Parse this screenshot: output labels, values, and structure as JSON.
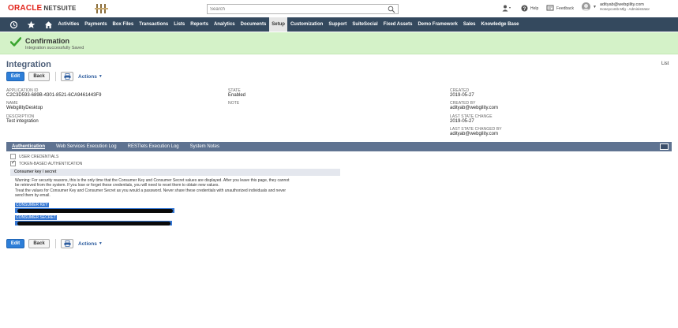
{
  "header": {
    "logo_oracle": "ORACLE",
    "logo_netsuite": "NETSUITE",
    "search_placeholder": "Search",
    "help_label": "Help",
    "feedback_label": "Feedback",
    "user_email": "adityab@webgility.com",
    "user_role": "Honeycomb Mfg - Administrator"
  },
  "nav": {
    "items": [
      "Activities",
      "Payments",
      "Box Files",
      "Transactions",
      "Lists",
      "Reports",
      "Analytics",
      "Documents",
      "Setup",
      "Customization",
      "Support",
      "SuiteSocial",
      "Fixed Assets",
      "Demo Framework",
      "Sales",
      "Knowledge Base"
    ],
    "active": "Setup"
  },
  "confirmation": {
    "title": "Confirmation",
    "message": "Integration successfully Saved"
  },
  "page": {
    "title": "Integration",
    "list_link": "List"
  },
  "buttons": {
    "edit": "Edit",
    "back": "Back",
    "actions": "Actions"
  },
  "fields": {
    "application_id_label": "APPLICATION ID",
    "application_id": "C2C3D593-689B-4301-8521-6CA9461443F9",
    "name_label": "NAME",
    "name": "WebgilityDesktop",
    "description_label": "DESCRIPTION",
    "description": "Test integration",
    "state_label": "STATE",
    "state": "Enabled",
    "note_label": "NOTE",
    "created_label": "CREATED",
    "created": "2019-05-27",
    "created_by_label": "CREATED BY",
    "created_by": "adityab@webgility.com",
    "last_state_change_label": "LAST STATE CHANGE",
    "last_state_change": "2019-05-27",
    "last_state_changed_by_label": "LAST STATE CHANGED BY",
    "last_state_changed_by": "adityab@webgility.com"
  },
  "subtabs": {
    "authentication": "Authentication",
    "web_services_log": "Web Services Execution Log",
    "restlets_log": "RESTlets Execution Log",
    "system_notes": "System Notes"
  },
  "auth": {
    "user_credentials": "USER CREDENTIALS",
    "user_credentials_checked": false,
    "token_based": "TOKEN-BASED AUTHENTICATION",
    "token_based_checked": true,
    "section_title": "Consumer key / secret",
    "warning_1": "Warning: For security reasons, this is the only time that the Consumer Key and Consumer Secret values are displayed. After you leave this page, they cannot",
    "warning_2": "be retrieved from the system. If you lose or forget these credentials, you will need to reset them to obtain new values.",
    "warning_3": "Treat the values for Consumer Key and Consumer Secret as you would a password. Never share these credentials with unauthorized individuals and never",
    "warning_4": "send them by email.",
    "consumer_key_label": "CONSUMER KEY",
    "consumer_secret_label": "CONSUMER SECRET"
  },
  "colors": {
    "nav_bg": "#34495e",
    "confirm_bg": "#d4f2c8",
    "primary_button": "#2d7ed8",
    "subtab_bg": "#5f7391",
    "selection": "#3577d3"
  }
}
